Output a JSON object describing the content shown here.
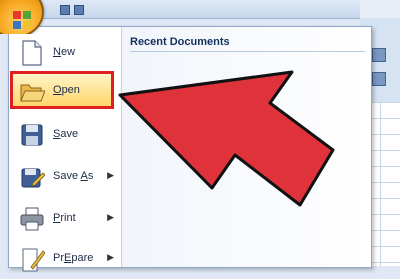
{
  "menu": {
    "items": [
      {
        "label": "New",
        "accel": "N",
        "rest": "ew",
        "submenu": false
      },
      {
        "label": "Open",
        "accel": "O",
        "rest": "pen",
        "submenu": false,
        "highlighted": true
      },
      {
        "label": "Save",
        "accel": "S",
        "rest": "ave",
        "submenu": false
      },
      {
        "label": "Save As",
        "accel": "A",
        "pre": "Save ",
        "rest": "s",
        "submenu": true
      },
      {
        "label": "Print",
        "accel": "P",
        "rest": "rint",
        "submenu": true
      },
      {
        "label": "Prepare",
        "accel": "E",
        "pre": "Pr",
        "rest": "pare",
        "submenu": true
      }
    ],
    "recent_title": "Recent Documents"
  },
  "icons": [
    "office-button-icon",
    "new-document-icon",
    "open-folder-icon",
    "save-disk-icon",
    "save-as-icon",
    "print-icon",
    "prepare-icon"
  ],
  "colors": {
    "highlight_border": "#e02020",
    "arrow_fill": "#e0323a"
  }
}
